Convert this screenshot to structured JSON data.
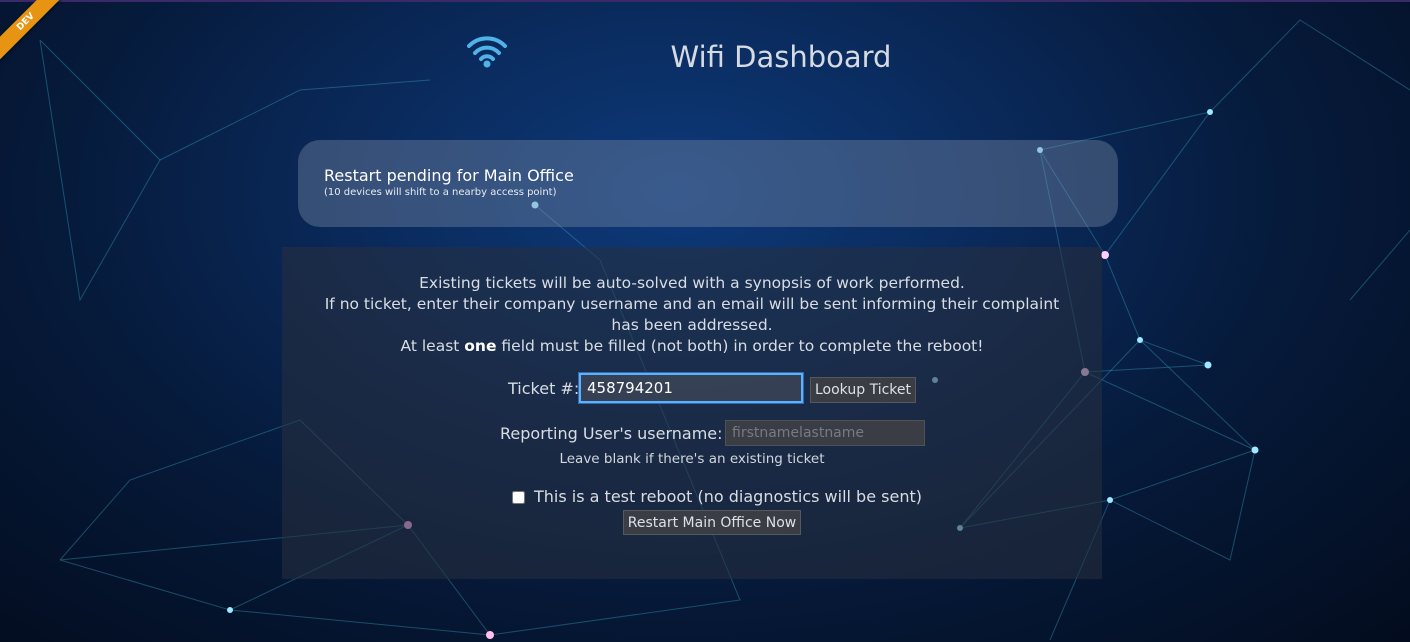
{
  "env_badge": "DEV",
  "app": {
    "title": "Wifi Dashboard",
    "logo_icon": "wifi-icon"
  },
  "status": {
    "title": "Restart pending for Main Office",
    "subtitle": "(10 devices will shift to a nearby access point)"
  },
  "instructions": {
    "line1": "Existing tickets will be auto-solved with a synopsis of work performed.",
    "line2": "If no ticket, enter their company username and an email will be sent informing their complaint has been addressed.",
    "line3_prefix": "At least ",
    "line3_bold": "one",
    "line3_suffix": " field must be filled (not both) in order to complete the reboot!"
  },
  "ticket": {
    "label": "Ticket #:",
    "value": "458794201",
    "lookup_label": "Lookup Ticket"
  },
  "username": {
    "label": "Reporting User's username:",
    "placeholder": "firstnamelastname",
    "hint": "Leave blank if there's an existing ticket"
  },
  "test_reboot": {
    "label": "This is a test reboot (no diagnostics will be sent)",
    "checked": false
  },
  "restart_button": "Restart Main Office Now",
  "colors": {
    "ribbon": "#e69412",
    "accent": "#5fb0ff",
    "wifi_icon": "#4fb3e8"
  }
}
